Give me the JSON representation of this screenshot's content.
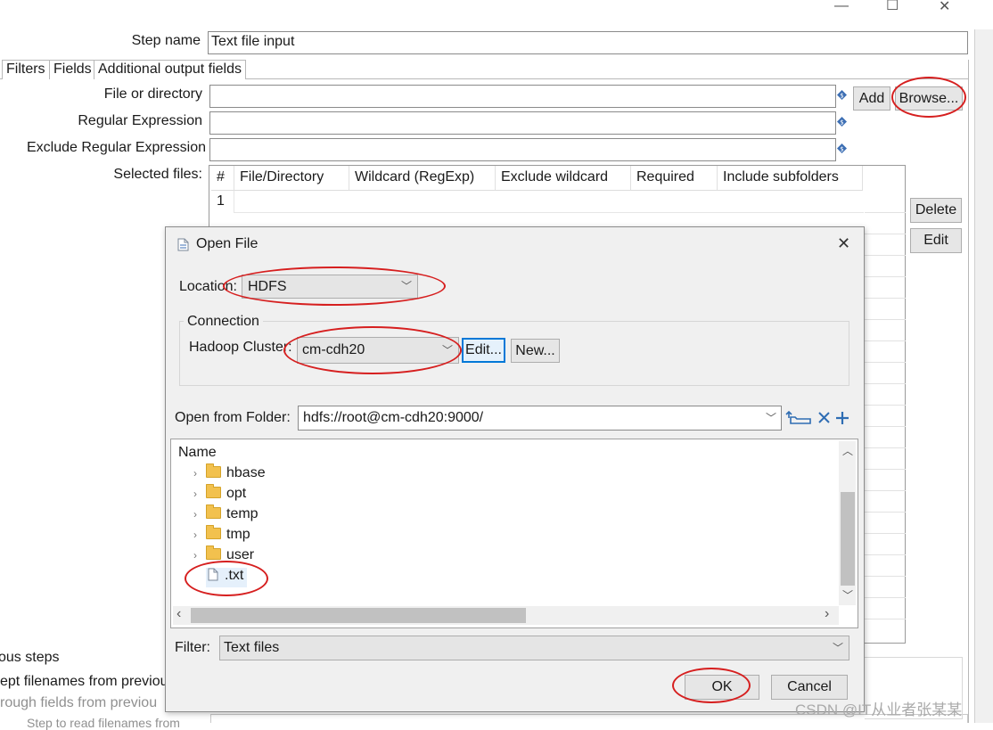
{
  "window": {
    "minimize": "—",
    "maximize": "☐",
    "close": "✕"
  },
  "step": {
    "label": "Step name",
    "value": "Text file input"
  },
  "tabs": [
    "Filters",
    "Fields",
    "Additional output fields"
  ],
  "form": {
    "file_label": "File or directory",
    "regex_label": "Regular Expression",
    "exclude_label": "Exclude Regular Expression",
    "selected_label": "Selected files:",
    "add_btn": "Add",
    "browse_btn": "Browse...",
    "delete_btn": "Delete",
    "edit_btn": "Edit"
  },
  "files_table": {
    "columns": [
      "#",
      "File/Directory",
      "Wildcard (RegExp)",
      "Exclude wildcard",
      "Required",
      "Include subfolders"
    ],
    "rows": [
      [
        "1",
        "",
        "",
        "",
        "",
        ""
      ]
    ]
  },
  "lower": {
    "prev_steps": "ous steps",
    "accept_filenames": "ept filenames from previou",
    "pass_through": "rough fields from previou",
    "step_to_read": "Step to read filenames from"
  },
  "dialog": {
    "title": "Open File",
    "close": "✕",
    "location_label": "Location:",
    "location_value": "HDFS",
    "connection_legend": "Connection",
    "cluster_label": "Hadoop Cluster:",
    "cluster_value": "cm-cdh20",
    "edit_btn": "Edit...",
    "new_btn": "New...",
    "folder_label": "Open from Folder:",
    "folder_value": "hdfs://root@cm-cdh20:9000/",
    "tree_header": "Name",
    "items": [
      {
        "name": "hbase",
        "type": "folder"
      },
      {
        "name": "opt",
        "type": "folder"
      },
      {
        "name": "temp",
        "type": "folder"
      },
      {
        "name": "tmp",
        "type": "folder"
      },
      {
        "name": "user",
        "type": "folder"
      },
      {
        "name": ".txt",
        "type": "file"
      }
    ],
    "filter_label": "Filter:",
    "filter_value": "Text files",
    "ok_btn": "OK",
    "cancel_btn": "Cancel"
  },
  "watermark": "CSDN @IT从业者张某某",
  "colors": {
    "annotation": "#d61f1f",
    "selected_blue": "#0078d7"
  }
}
